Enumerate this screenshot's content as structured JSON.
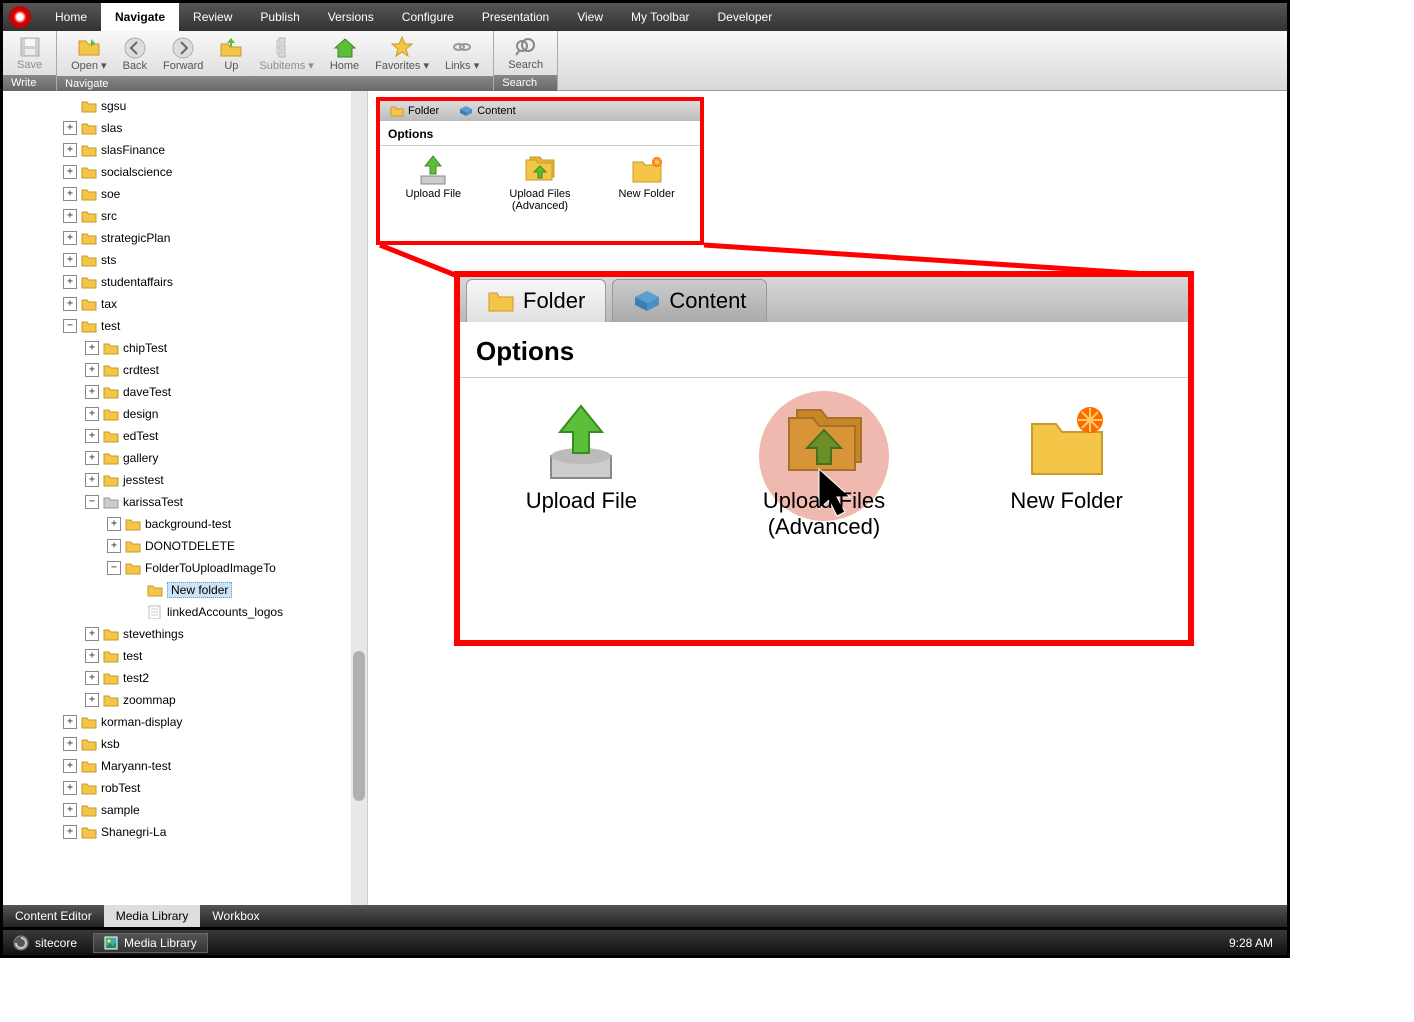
{
  "menubar": [
    "Home",
    "Navigate",
    "Review",
    "Publish",
    "Versions",
    "Configure",
    "Presentation",
    "View",
    "My Toolbar",
    "Developer"
  ],
  "menubar_active": "Navigate",
  "ribbon": {
    "groups": [
      {
        "label": "Write",
        "buttons": [
          {
            "label": "Save",
            "icon": "save",
            "dropdown": false,
            "disabled": true
          }
        ]
      },
      {
        "label": "Navigate",
        "buttons": [
          {
            "label": "Open",
            "icon": "open",
            "dropdown": true
          },
          {
            "label": "Back",
            "icon": "back"
          },
          {
            "label": "Forward",
            "icon": "forward"
          },
          {
            "label": "Up",
            "icon": "up"
          },
          {
            "label": "Subitems",
            "icon": "subitems",
            "dropdown": true,
            "disabled": true
          },
          {
            "label": "Home",
            "icon": "home"
          },
          {
            "label": "Favorites",
            "icon": "fav",
            "dropdown": true
          },
          {
            "label": "Links",
            "icon": "links",
            "dropdown": true
          }
        ]
      },
      {
        "label": "Search",
        "buttons": [
          {
            "label": "Search",
            "icon": "search"
          }
        ]
      }
    ]
  },
  "tree": [
    {
      "label": "sgsu",
      "indent": 1,
      "toggle": "blank",
      "cut": true
    },
    {
      "label": "slas",
      "indent": 1,
      "toggle": "+"
    },
    {
      "label": "slasFinance",
      "indent": 1,
      "toggle": "+"
    },
    {
      "label": "socialscience",
      "indent": 1,
      "toggle": "+"
    },
    {
      "label": "soe",
      "indent": 1,
      "toggle": "+"
    },
    {
      "label": "src",
      "indent": 1,
      "toggle": "+"
    },
    {
      "label": "strategicPlan",
      "indent": 1,
      "toggle": "+"
    },
    {
      "label": "sts",
      "indent": 1,
      "toggle": "+"
    },
    {
      "label": "studentaffairs",
      "indent": 1,
      "toggle": "+"
    },
    {
      "label": "tax",
      "indent": 1,
      "toggle": "+"
    },
    {
      "label": "test",
      "indent": 1,
      "toggle": "-"
    },
    {
      "label": "chipTest",
      "indent": 2,
      "toggle": "+"
    },
    {
      "label": "crdtest",
      "indent": 2,
      "toggle": "+"
    },
    {
      "label": "daveTest",
      "indent": 2,
      "toggle": "+"
    },
    {
      "label": "design",
      "indent": 2,
      "toggle": "+"
    },
    {
      "label": "edTest",
      "indent": 2,
      "toggle": "+"
    },
    {
      "label": "gallery",
      "indent": 2,
      "toggle": "+"
    },
    {
      "label": "jesstest",
      "indent": 2,
      "toggle": "+"
    },
    {
      "label": "karissaTest",
      "indent": 2,
      "toggle": "-",
      "gray": true
    },
    {
      "label": "background-test",
      "indent": 3,
      "toggle": "+"
    },
    {
      "label": "DONOTDELETE",
      "indent": 3,
      "toggle": "+"
    },
    {
      "label": "FolderToUploadImageTo",
      "indent": 3,
      "toggle": "-"
    },
    {
      "label": "New folder",
      "indent": 4,
      "toggle": "blank",
      "selected": true
    },
    {
      "label": "linkedAccounts_logos",
      "indent": 4,
      "toggle": "blank",
      "file": true
    },
    {
      "label": "stevethings",
      "indent": 2,
      "toggle": "+"
    },
    {
      "label": "test",
      "indent": 2,
      "toggle": "+"
    },
    {
      "label": "test2",
      "indent": 2,
      "toggle": "+"
    },
    {
      "label": "zoommap",
      "indent": 2,
      "toggle": "+"
    },
    {
      "label": "korman-display",
      "indent": 1,
      "toggle": "+"
    },
    {
      "label": "ksb",
      "indent": 1,
      "toggle": "+"
    },
    {
      "label": "Maryann-test",
      "indent": 1,
      "toggle": "+"
    },
    {
      "label": "robTest",
      "indent": 1,
      "toggle": "+"
    },
    {
      "label": "sample",
      "indent": 1,
      "toggle": "+"
    },
    {
      "label": "Shanegri-La",
      "indent": 1,
      "toggle": "+"
    }
  ],
  "panel": {
    "tabs": [
      {
        "label": "Folder",
        "icon": "folder",
        "active": true
      },
      {
        "label": "Content",
        "icon": "cube",
        "active": false
      }
    ],
    "heading": "Options",
    "options": [
      {
        "label": "Upload File",
        "icon": "upload"
      },
      {
        "label": "Upload Files (Advanced)",
        "icon": "upload-multi",
        "highlighted": true
      },
      {
        "label": "New Folder",
        "icon": "new-folder"
      }
    ]
  },
  "bottom_tabs": [
    "Content Editor",
    "Media Library",
    "Workbox"
  ],
  "bottom_active": "Media Library",
  "taskbar": {
    "start": "sitecore",
    "app": "Media Library",
    "clock": "9:28 AM"
  }
}
